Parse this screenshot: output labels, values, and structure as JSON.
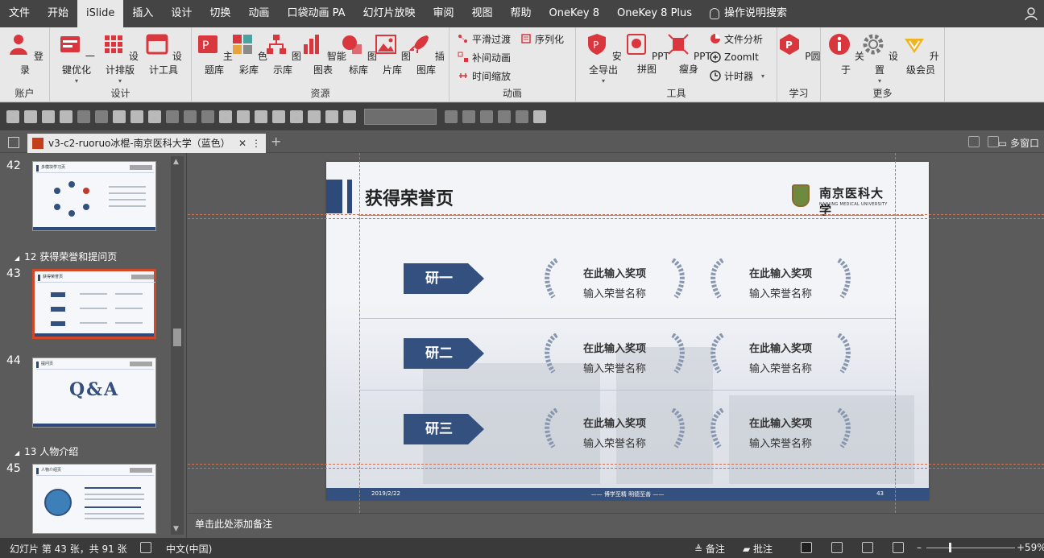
{
  "menu": {
    "tabs": [
      "文件",
      "开始",
      "iSlide",
      "插入",
      "设计",
      "切换",
      "动画",
      "口袋动画 PA",
      "幻灯片放映",
      "审阅",
      "视图",
      "帮助",
      "OneKey 8",
      "OneKey 8 Plus"
    ],
    "active_tab": "iSlide",
    "help_search": "操作说明搜索"
  },
  "ribbon": {
    "groups": {
      "account": {
        "label": "账户",
        "login": "登录"
      },
      "design": {
        "label": "设计",
        "optimize": "一键优化",
        "layout": "设计排版",
        "tools": "设计工具"
      },
      "resources": {
        "label": "资源",
        "theme": "主题库",
        "color": "色彩库",
        "diagram": "图示库",
        "chart": "智能图表",
        "icon": "图标库",
        "image": "图片库",
        "illustration": "插图库"
      },
      "animation": {
        "label": "动画",
        "smooth": "平滑过渡",
        "serialize": "序列化",
        "tween": "补间动画",
        "time_scale": "时间缩放"
      },
      "tools": {
        "label": "工具",
        "safe_export": "安全导出",
        "ppt_collage": "PPT拼图",
        "ppt_slim": "PPT瘦身",
        "file_analysis": "文件分析",
        "zoomit": "ZoomIt",
        "timer": "计时器"
      },
      "learn": {
        "label": "学习",
        "p_garden": "P圆"
      },
      "more": {
        "label": "更多",
        "about": "关于",
        "settings": "设置",
        "upgrade": "升级会员"
      }
    }
  },
  "doc": {
    "tab_title": "v3-c2-ruoruo冰棍-南京医科大学（蓝色）",
    "right_label": "多窗口"
  },
  "thumbnails": [
    {
      "num": "42",
      "title": "多模块学习页"
    },
    {
      "section": "12 获得荣誉和提问页"
    },
    {
      "num": "43",
      "title": "获得荣誉页",
      "selected": true
    },
    {
      "num": "44",
      "title": "提问页",
      "qa": "Q&A"
    },
    {
      "section": "13 人物介绍"
    },
    {
      "num": "45",
      "title": "人物介绍页"
    }
  ],
  "slide": {
    "title": "获得荣誉页",
    "logo_cn": "南京医科大学",
    "logo_en": "NANJING MEDICAL UNIVERSITY",
    "rows": [
      {
        "grade": "研一",
        "awards": [
          {
            "title": "在此输入奖项",
            "name": "输入荣誉名称"
          },
          {
            "title": "在此输入奖项",
            "name": "输入荣誉名称"
          }
        ]
      },
      {
        "grade": "研二",
        "awards": [
          {
            "title": "在此输入奖项",
            "name": "输入荣誉名称"
          },
          {
            "title": "在此输入奖项",
            "name": "输入荣誉名称"
          }
        ]
      },
      {
        "grade": "研三",
        "awards": [
          {
            "title": "在此输入奖项",
            "name": "输入荣誉名称"
          },
          {
            "title": "在此输入奖项",
            "name": "输入荣誉名称"
          }
        ]
      }
    ],
    "footer_date": "2019/2/22",
    "footer_motto": "—— 博学至精  明德至善 ——",
    "footer_page": "43",
    "accent": "#34507e"
  },
  "notes_placeholder": "单击此处添加备注",
  "status": {
    "slide_info": "幻灯片 第 43 张，共 91 张",
    "language": "中文(中国)",
    "notes": "备注",
    "comments": "批注",
    "zoom": "59%"
  }
}
